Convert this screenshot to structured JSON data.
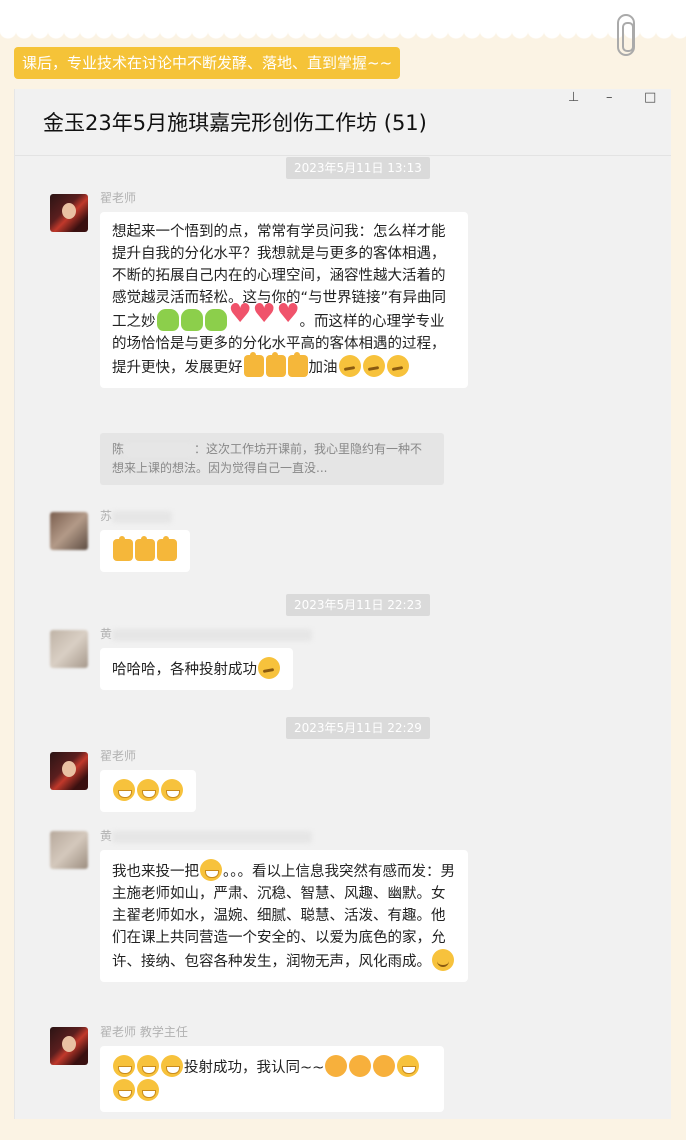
{
  "banner": "课后，专业技术在讨论中不断发酵、落地、直到掌握~~",
  "window": {
    "title": "金玉23年5月施琪嘉完形创伤工作坊 (51)",
    "pin_icon": "pin-icon",
    "minimize_icon": "minimize-icon",
    "maximize_icon": "maximize-icon"
  },
  "timestamps": [
    "2023年5月11日 13:13",
    "2023年5月11日 22:23",
    "2023年5月11日 22:29"
  ],
  "messages": [
    {
      "sender": "翟老师",
      "text_1": "想起来一个悟到的点，常常有学员问我：怎么样才能提升自我的分化水平？我想就是与更多的客体相遇，不断的拓展自己内在的心理空间，涵容性越大活着的感觉越灵活而轻松。这与你的“与世界链接”有异曲同工之妙",
      "text_2": "。而这样的心理学专业的场恰恰是与更多的分化水平高的客体相遇的过程，提升更快，发展更好",
      "text_3": "加油",
      "quote_name": "陈",
      "quote_text": "：这次工作坊开课前，我心里隐约有一种不想来上课的想法。因为觉得自己一直没..."
    },
    {
      "sender": "苏"
    },
    {
      "sender": "黄",
      "text": "哈哈哈，各种投射成功"
    },
    {
      "sender": "翟老师"
    },
    {
      "sender": "黄",
      "text_1": "我也来投一把",
      "text_2": "。。。看以上信息我突然有感而发：男主施老师如山，严肃、沉稳、智慧、风趣、幽默。女主翟老师如水，温婉、细腻、聪慧、活泼、有趣。他们在课上共同营造一个安全的、以爱为底色的家，允许、接纳、包容各种发生，润物无声，风化雨成。"
    },
    {
      "sender": "翟老师",
      "role": "教学主任",
      "text": "投射成功，我认同~~"
    }
  ]
}
